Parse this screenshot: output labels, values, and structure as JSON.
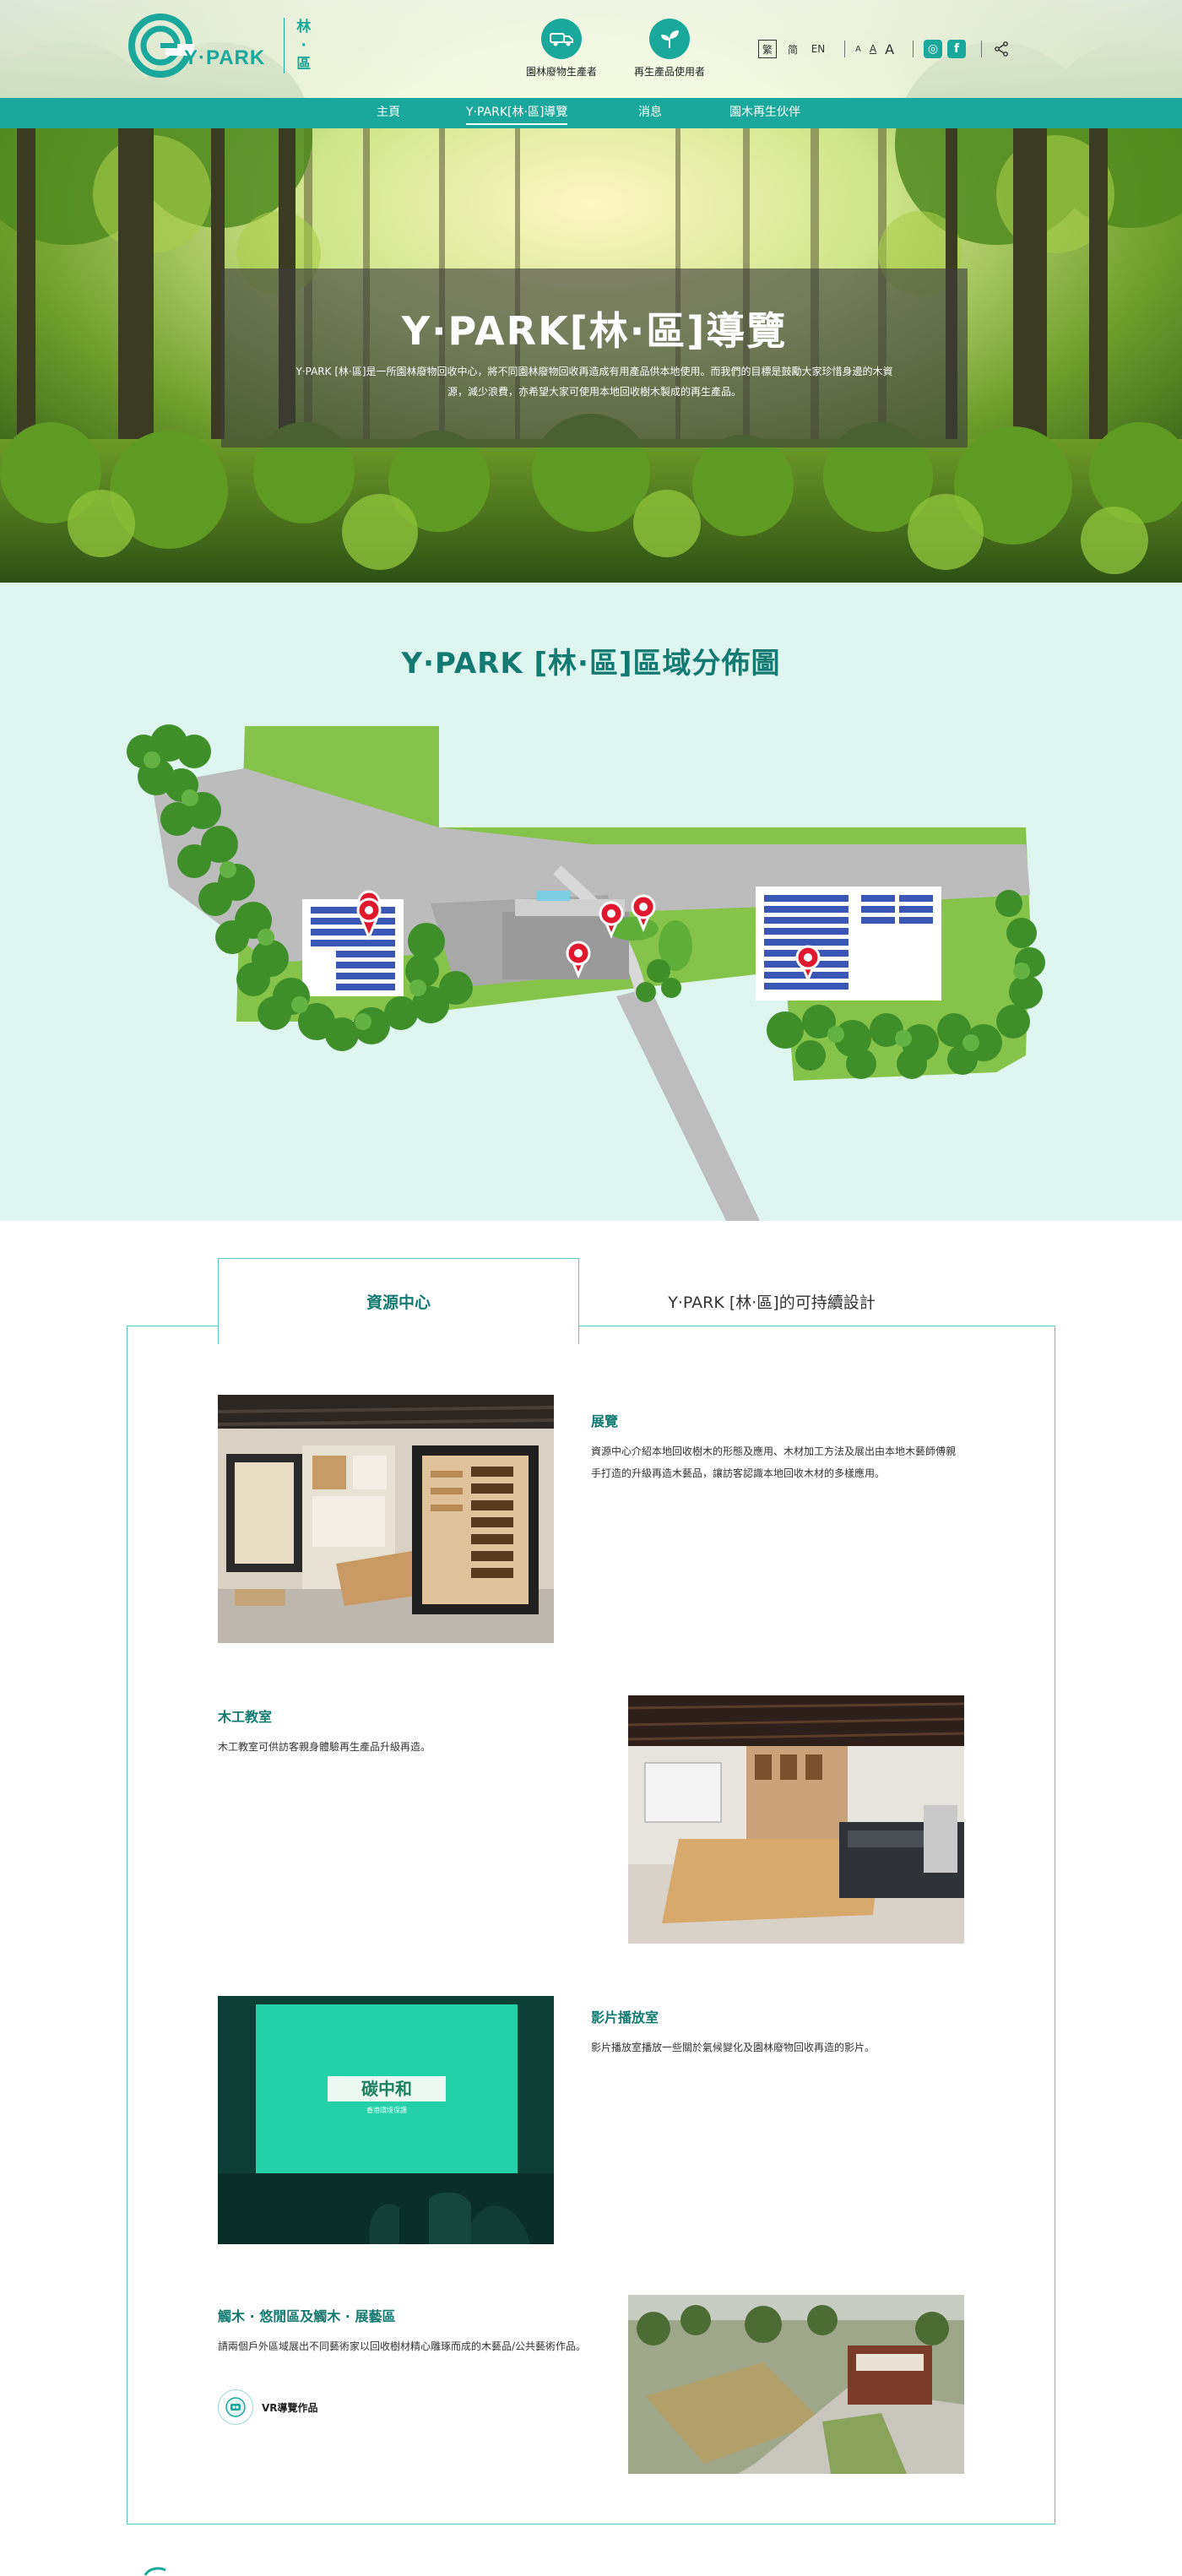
{
  "brand": {
    "logo_text": "Y·PARK",
    "sub_char_1": "林",
    "sub_char_2": "·",
    "sub_char_3": "區"
  },
  "top_links": [
    {
      "label": "園林廢物生產者",
      "icon": "truck-icon"
    },
    {
      "label": "再生產品使用者",
      "icon": "sprout-icon"
    }
  ],
  "utils": {
    "langs": [
      "繁",
      "简",
      "EN"
    ],
    "active_lang": "繁",
    "font_sizes": [
      "A",
      "A",
      "A"
    ],
    "social": [
      {
        "name": "instagram-icon",
        "glyph": "◎"
      },
      {
        "name": "facebook-icon",
        "glyph": "f"
      }
    ],
    "share_icon": "share-icon"
  },
  "nav": {
    "items": [
      "主頁",
      "Y·PARK[林·區]導覽",
      "消息",
      "園木再生伙伴"
    ],
    "active": 1
  },
  "hero": {
    "title": "Y·PARK[林·區]導覽",
    "desc_line1": "Y·PARK [林·區]是一所園林廢物回收中心，將不同園林廢物回收再造成有用產品供本地使用。而我們的目標是鼓勵大家珍惜身邊的木資",
    "desc_line2": "源，減少浪費，亦希望大家可使用本地回收樹木製成的再生產品。"
  },
  "map": {
    "title": "Y·PARK [林·區]區域分佈圖",
    "pins": [
      "pin-resource-centre",
      "pin-workshop",
      "pin-theatre",
      "pin-yard",
      "pin-gallery"
    ]
  },
  "tabs": {
    "items": [
      "資源中心",
      "Y·PARK [林·區]的可持續設計"
    ],
    "active": 0
  },
  "features": [
    {
      "title": "展覽",
      "desc": "資源中心介紹本地回收樹木的形態及應用、木材加工方法及展出由本地木藝師傅親手打造的升級再造木藝品，讓訪客認識本地回收木材的多樣應用。"
    },
    {
      "title": "木工教室",
      "desc": "木工教室可供訪客親身體驗再生產品升級再造。"
    },
    {
      "title": "影片播放室",
      "desc": "影片播放室播放一些關於氣候變化及園林廢物回收再造的影片。"
    },
    {
      "title": "觸木 · 悠閒區及觸木 · 展藝區",
      "desc": "請兩個戶外區域展出不同藝術家以回收樹材精心雕琢而成的木藝品/公共藝術作品。"
    }
  ],
  "vr": {
    "label": "VR導覽作品"
  },
  "screen": {
    "logo_text": "碳中和",
    "sub_text": "香港環境保護"
  }
}
